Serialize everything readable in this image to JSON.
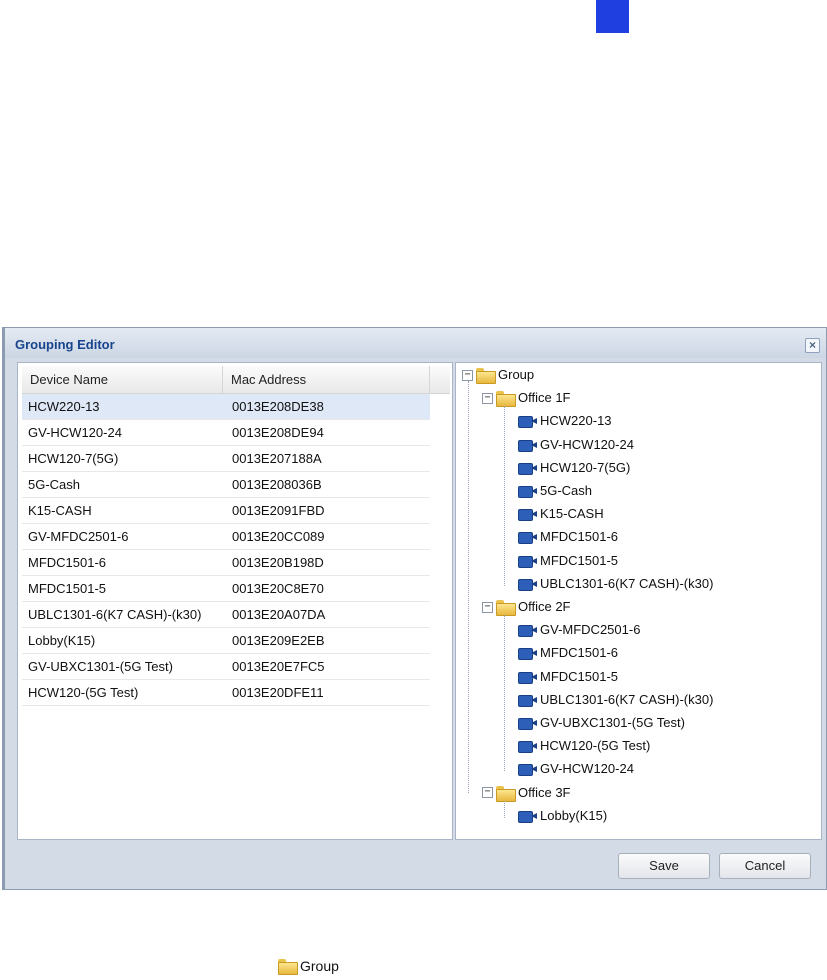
{
  "dialog": {
    "title": "Grouping Editor",
    "close_label": "×",
    "save_label": "Save",
    "cancel_label": "Cancel"
  },
  "table": {
    "columns": [
      "Device Name",
      "Mac Address"
    ],
    "rows": [
      {
        "name": "HCW220-13",
        "mac": "0013E208DE38",
        "selected": true
      },
      {
        "name": "GV-HCW120-24",
        "mac": "0013E208DE94"
      },
      {
        "name": "HCW120-7(5G)",
        "mac": "0013E207188A"
      },
      {
        "name": "5G-Cash",
        "mac": "0013E208036B"
      },
      {
        "name": "K15-CASH",
        "mac": "0013E2091FBD"
      },
      {
        "name": "GV-MFDC2501-6",
        "mac": "0013E20CC089"
      },
      {
        "name": "MFDC1501-6",
        "mac": "0013E20B198D"
      },
      {
        "name": "MFDC1501-5",
        "mac": "0013E20C8E70"
      },
      {
        "name": "UBLC1301-6(K7 CASH)-(k30)",
        "mac": "0013E20A07DA"
      },
      {
        "name": "Lobby(K15)",
        "mac": "0013E209E2EB"
      },
      {
        "name": "GV-UBXC1301-(5G Test)",
        "mac": "0013E20E7FC5"
      },
      {
        "name": "HCW120-(5G Test)",
        "mac": "0013E20DFE11"
      }
    ]
  },
  "tree": {
    "root": "Group",
    "groups": [
      {
        "name": "Office 1F",
        "devices": [
          "HCW220-13",
          "GV-HCW120-24",
          "HCW120-7(5G)",
          "5G-Cash",
          "K15-CASH",
          "MFDC1501-6",
          "MFDC1501-5",
          "UBLC1301-6(K7 CASH)-(k30)"
        ]
      },
      {
        "name": "Office 2F",
        "devices": [
          "GV-MFDC2501-6",
          "MFDC1501-6",
          "MFDC1501-5",
          "UBLC1301-6(K7 CASH)-(k30)",
          "GV-UBXC1301-(5G Test)",
          "HCW120-(5G Test)",
          "GV-HCW120-24"
        ]
      },
      {
        "name": "Office 3F",
        "devices": [
          "Lobby(K15)"
        ]
      }
    ]
  },
  "legend": {
    "label": "Group"
  },
  "colors": {
    "title": "#17448c",
    "selected_row": "#dfe8f6",
    "page_tab": "#1f3fe0"
  }
}
